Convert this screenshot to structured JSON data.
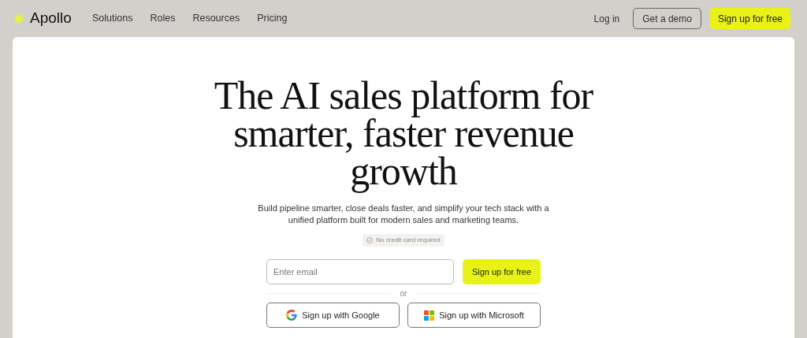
{
  "header": {
    "brand": "Apollo",
    "nav": [
      "Solutions",
      "Roles",
      "Resources",
      "Pricing"
    ],
    "login": "Log in",
    "demo": "Get a demo",
    "signup": "Sign up for free"
  },
  "hero": {
    "headline": [
      "The AI sales platform for",
      "smarter, faster revenue",
      "growth"
    ],
    "subtitle": "Build pipeline smarter, close deals faster, and simplify your tech stack with a unified platform built for modern sales and marketing teams.",
    "badge": "No credit card required",
    "email": {
      "placeholder": "Enter email"
    },
    "submit": "Sign up for free",
    "divider": "or",
    "providers": [
      {
        "kind": "google",
        "label": "Sign up with Google"
      },
      {
        "kind": "microsoft",
        "label": "Sign up with Microsoft"
      }
    ]
  }
}
